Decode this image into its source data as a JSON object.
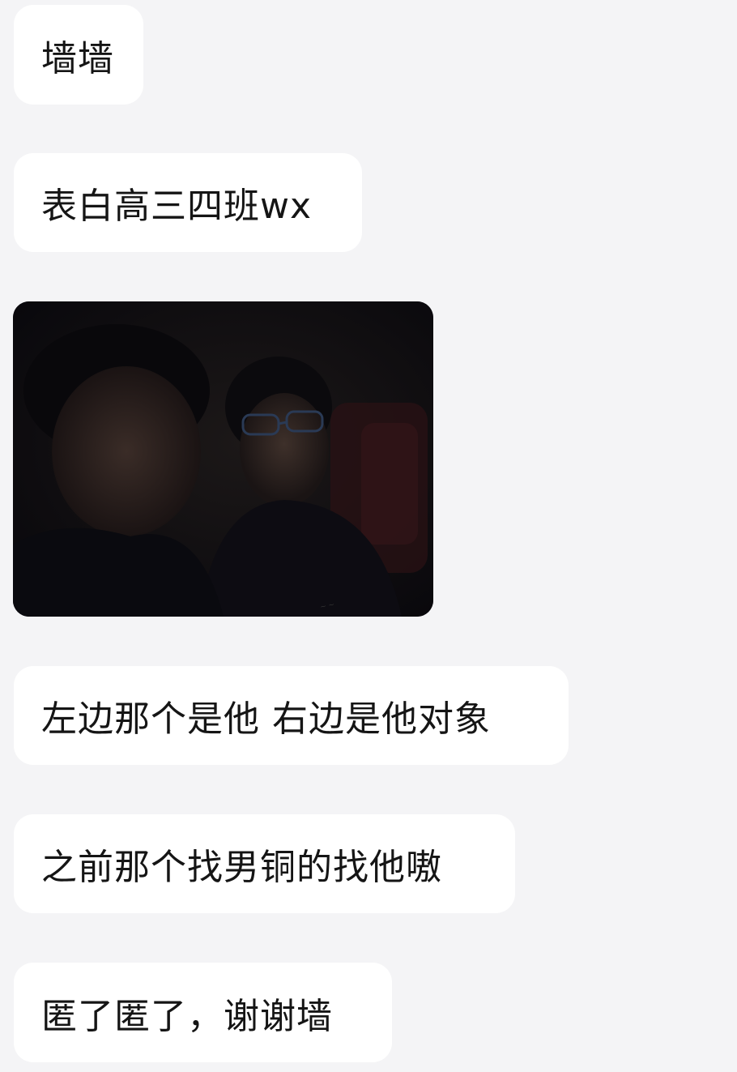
{
  "messages": [
    {
      "type": "text",
      "text": "墙墙"
    },
    {
      "type": "text",
      "text": "表白高三四班wx"
    },
    {
      "type": "image",
      "icon": "photo-thumbnail"
    },
    {
      "type": "text",
      "text": "左边那个是他 右边是他对象"
    },
    {
      "type": "text",
      "text": "之前那个找男铜的找他嗷"
    },
    {
      "type": "text",
      "text": "匿了匿了，谢谢墙"
    }
  ],
  "colors": {
    "background": "#f4f4f6",
    "bubble": "#ffffff",
    "text": "#151515"
  }
}
